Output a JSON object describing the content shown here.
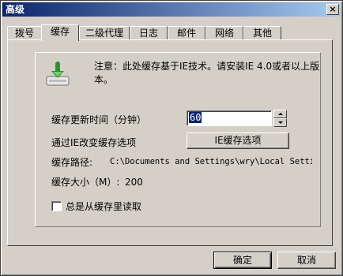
{
  "window": {
    "title": "高级",
    "close_symbol": "×"
  },
  "tabs": [
    {
      "label": "拨号"
    },
    {
      "label": "缓存"
    },
    {
      "label": "二级代理"
    },
    {
      "label": "日志"
    },
    {
      "label": "邮件"
    },
    {
      "label": "网络"
    },
    {
      "label": "其他"
    }
  ],
  "active_tab": "缓存",
  "cache": {
    "icon": "download-arrow-icon",
    "notice": "注意：此处缓存基于IE技术。请安装IE 4.0或者以上版本。",
    "update_time_label": "缓存更新时间（分钟）",
    "update_time_value": "60",
    "ie_change_label": "通过IE改变缓存选项",
    "ie_options_button": "IE缓存选项",
    "path_label": "缓存路径:",
    "path_value": "C:\\Documents and Settings\\wry\\Local Settings",
    "size_label": "缓存大小（M）:",
    "size_value": "200",
    "always_read_label": "总是从缓存里读取",
    "always_read_checked": false
  },
  "footer": {
    "ok_label": "确定",
    "cancel_label": "取消"
  },
  "colors": {
    "titlebar_start": "#0a246a",
    "titlebar_end": "#a6caf0",
    "face": "#d4d0c8",
    "icon_green": "#3a9a3a"
  }
}
